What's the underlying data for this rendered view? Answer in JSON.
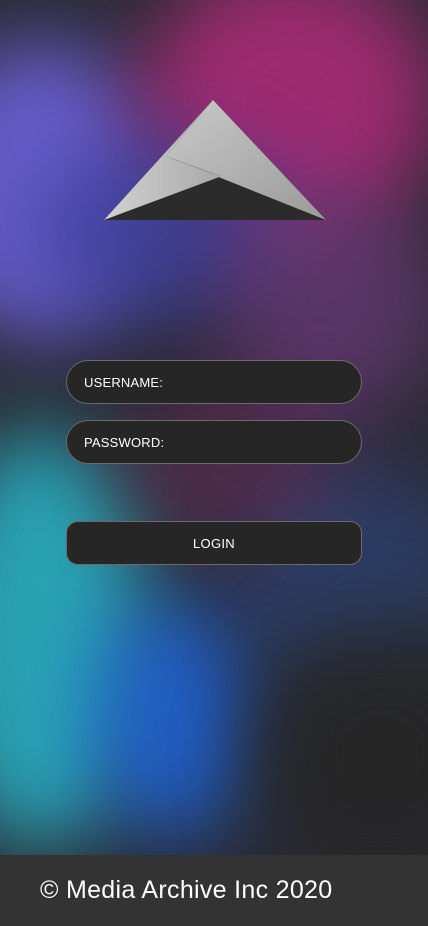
{
  "login_form": {
    "username_label": "USERNAME:",
    "password_label": "PASSWORD:",
    "login_button_label": "LOGIN"
  },
  "footer": {
    "copyright_text": "© Media Archive Inc 2020"
  },
  "logo": {
    "icon_name": "mountain-logo-icon"
  },
  "colors": {
    "field_background": "#262626",
    "field_border": "#6a6a6a",
    "footer_background": "#333333",
    "text": "#ffffff"
  }
}
